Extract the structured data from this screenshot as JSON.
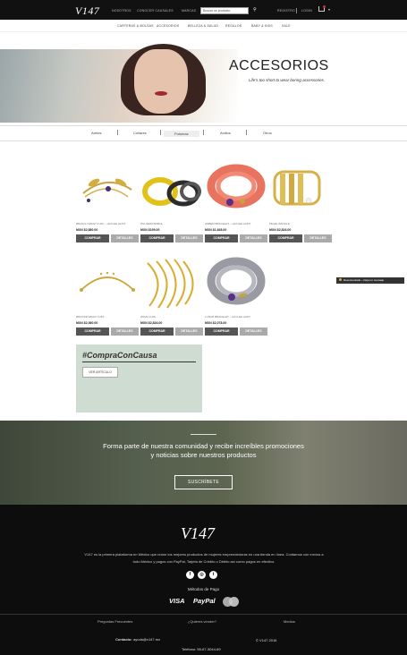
{
  "header": {
    "logo": "V147",
    "nav": [
      "NOSOTROS",
      "CONOCER CAUSALES",
      "MARCAS"
    ],
    "search_placeholder": "Buscar un producto",
    "account": [
      "REGISTRO",
      "LOGIN"
    ]
  },
  "categories": [
    "CARTERAS & BOLSAS",
    "ACCESORIOS",
    "BELLEZA & SALUD",
    "REGALOS",
    "BABY & KIDS",
    "SALE"
  ],
  "hero": {
    "title": "ACCESORIOS",
    "subtitle": "Life's too short to wear boring accessories."
  },
  "filters": [
    "Aretes",
    "Collares",
    "Pulseras",
    "Anillos",
    "Otros"
  ],
  "selected_filter": "Pulseras",
  "products": [
    {
      "name": "BRANCH WRAP CUFF – HAYLEE HUNT",
      "price": "MXN $2,880.00"
    },
    {
      "name": "PULSERA BOBLE",
      "price": "MXN $199.00"
    },
    {
      "name": "AMBER BRACELET – HAYLEE HUNT",
      "price": "MXN $1,648.00"
    },
    {
      "name": "PEARL BANGLE",
      "price": "MXN $2,816.00"
    },
    {
      "name": "BROOKE WRAP CUFF…",
      "price": "MXN $2,360.00"
    },
    {
      "name": "WAVE CUFF…",
      "price": "MXN $2,816.00"
    },
    {
      "name": "LUNAR BRACELET – HAYLEE HUNT",
      "price": "MXN $2,078.00"
    }
  ],
  "buttons": {
    "buy": "COMPRAR",
    "details": "DETALLES"
  },
  "cause": {
    "title": "#CompraConCausa",
    "button": "VER ARTÍCULO"
  },
  "chat": {
    "label": "Desconectado – Deja un mensaje"
  },
  "newsletter": {
    "line1": "Forma parte de nuestra comunidad y recibe increíbles promociones",
    "line2": "y noticias sobre nuestros productos",
    "button": "SUSCRÍBETE"
  },
  "footer": {
    "logo": "V147",
    "desc1": "V147 es la primera plataforma en México que reúne los mejores productos de mujeres emprendedoras en una tienda en línea. Contamos con envíos a",
    "desc2": "todo México y pagos con PayPal, Tarjeta de Crédito o Débito así como pagos en efectivo.",
    "social_icons": [
      "facebook-icon",
      "instagram-icon",
      "twitter-icon"
    ],
    "social_glyphs": [
      "f",
      "◎",
      "t"
    ],
    "payments_title": "Métodos de Pago",
    "payments": [
      "VISA",
      "PayPal"
    ],
    "links": [
      "Preguntas Frecuentes",
      "¿Quieres vender?",
      "Medios"
    ],
    "contact_label": "Contacto:",
    "contact_email": "ayuda@v147.mx",
    "copyright": "© V147 2016",
    "phone": "Teléfono: 55-67-3044-69"
  },
  "colors": {
    "dark": "#111111",
    "button_buy": "#555555",
    "button_details": "#aaaaaa",
    "cause_bg": "#cfdcd2"
  }
}
